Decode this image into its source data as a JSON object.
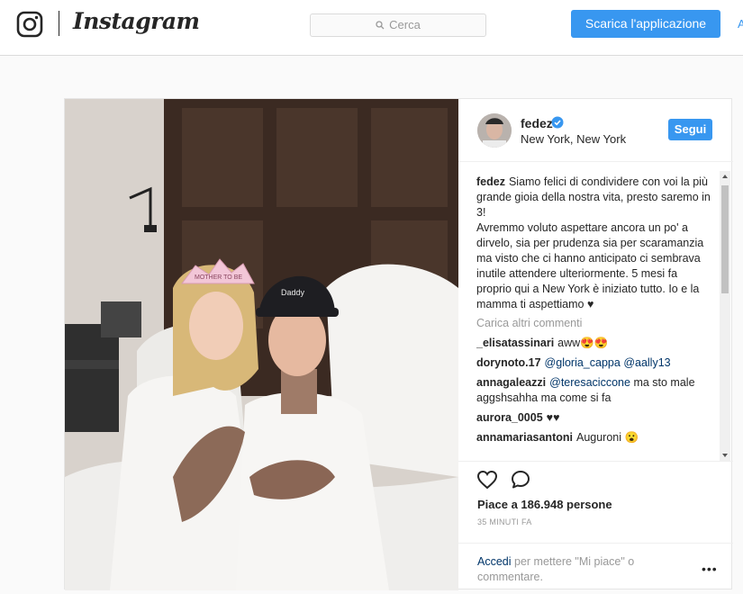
{
  "nav": {
    "wordmark": "Instagram",
    "search_placeholder": "Cerca",
    "download_label": "Scarica l'applicazione",
    "edge_label": "A"
  },
  "post": {
    "username": "fedez",
    "location": "New York, New York",
    "follow_label": "Segui",
    "caption": "Siamo felici di condividere con voi la più grande gioia della nostra vita, presto saremo in 3!\nAvremmo voluto aspettare ancora un po' a dirvelo, sia per prudenza sia per scaramanzia ma visto che ci hanno anticipato ci sembrava inutile attendere ulteriormente. 5 mesi fa proprio qui a New York è iniziato tutto. Io e la mamma ti aspettiamo ♥",
    "load_more": "Carica altri commenti",
    "comments": [
      {
        "user": "_elisatassinari",
        "text": "aww😍😍"
      },
      {
        "user": "dorynoto.17",
        "mentions": [
          "@gloria_cappa",
          "@aally13"
        ]
      },
      {
        "user": "annagaleazzi",
        "mention": "@teresaciccone",
        "text": "ma sto male aggshsahha ma come si fa"
      },
      {
        "user": "aurora_0005",
        "text": "♥♥"
      },
      {
        "user": "annamariasantoni",
        "text": "Auguroni 😮"
      }
    ],
    "likes": "Piace a 186.948 persone",
    "time_ago": "35 MINUTI FA",
    "login_link": "Accedi",
    "login_text": "per mettere \"Mi piace\" o commentare.",
    "more_label": "•••",
    "photo_cap_text": "Daddy",
    "photo_tiara_text": "MOTHER TO BE"
  },
  "colors": {
    "accent": "#3897f0",
    "text": "#262626",
    "muted": "#999999",
    "link": "#003569",
    "background": "#fafafa"
  },
  "icons": [
    "instagram-glyph-icon",
    "search-icon",
    "verified-badge-icon",
    "heart-icon",
    "comment-bubble-icon",
    "more-options-icon"
  ]
}
